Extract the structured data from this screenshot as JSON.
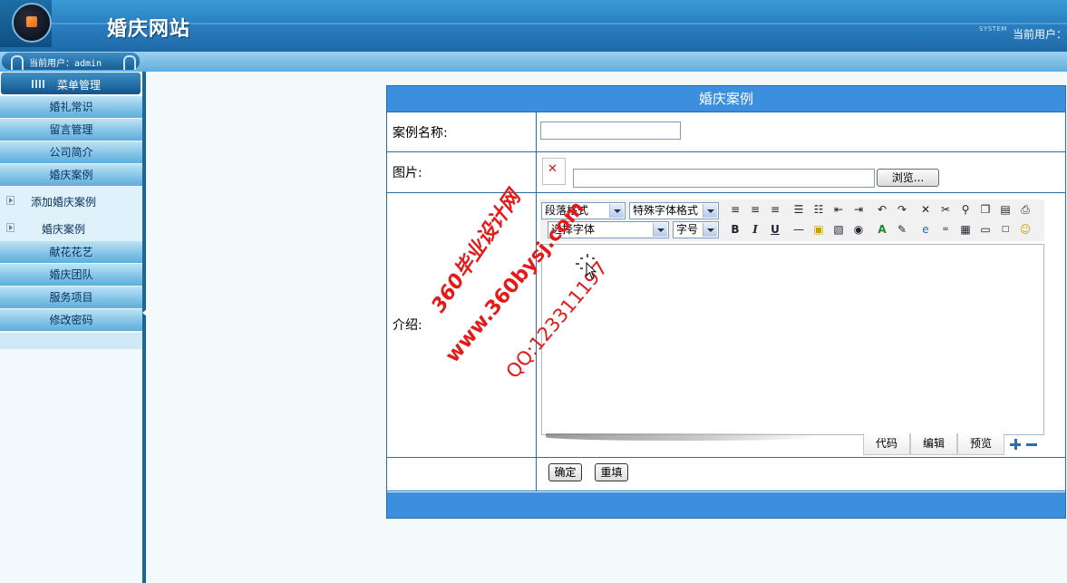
{
  "header": {
    "site_title": "婚庆网站",
    "system_tag": "SYSTEM",
    "current_user_label": "当前用户："
  },
  "subbar": {
    "user_text": "当前用户：admin"
  },
  "sidebar": {
    "menu_title": "菜单管理",
    "items": [
      {
        "label": "婚礼常识"
      },
      {
        "label": "留言管理"
      },
      {
        "label": "公司简介"
      },
      {
        "label": "婚庆案例"
      }
    ],
    "sub_items": [
      {
        "label": "添加婚庆案例"
      },
      {
        "label": "婚庆案例"
      }
    ],
    "items_after": [
      {
        "label": "献花花艺"
      },
      {
        "label": "婚庆团队"
      },
      {
        "label": "服务项目"
      },
      {
        "label": "修改密码"
      }
    ]
  },
  "form": {
    "title": "婚庆案例",
    "name_label": "案例名称:",
    "name_value": "",
    "image_label": "图片:",
    "file_value": "",
    "browse_label": "浏览...",
    "intro_label": "介绍:",
    "editor": {
      "paragraph_select": "段落格式",
      "special_font_select": "特殊字体格式",
      "font_select": "选择字体",
      "size_select": "字号",
      "tabs": [
        "代码",
        "编辑",
        "预览"
      ],
      "content": ""
    },
    "submit_label": "确定",
    "reset_label": "重填"
  },
  "watermark": {
    "line1": "360毕业设计网",
    "line2": "www.360bysj.com",
    "line3": "QQ:123311197"
  },
  "colors": {
    "title_bar": "#3b8fde",
    "border": "#2a6cab",
    "watermark": "#e81818"
  }
}
